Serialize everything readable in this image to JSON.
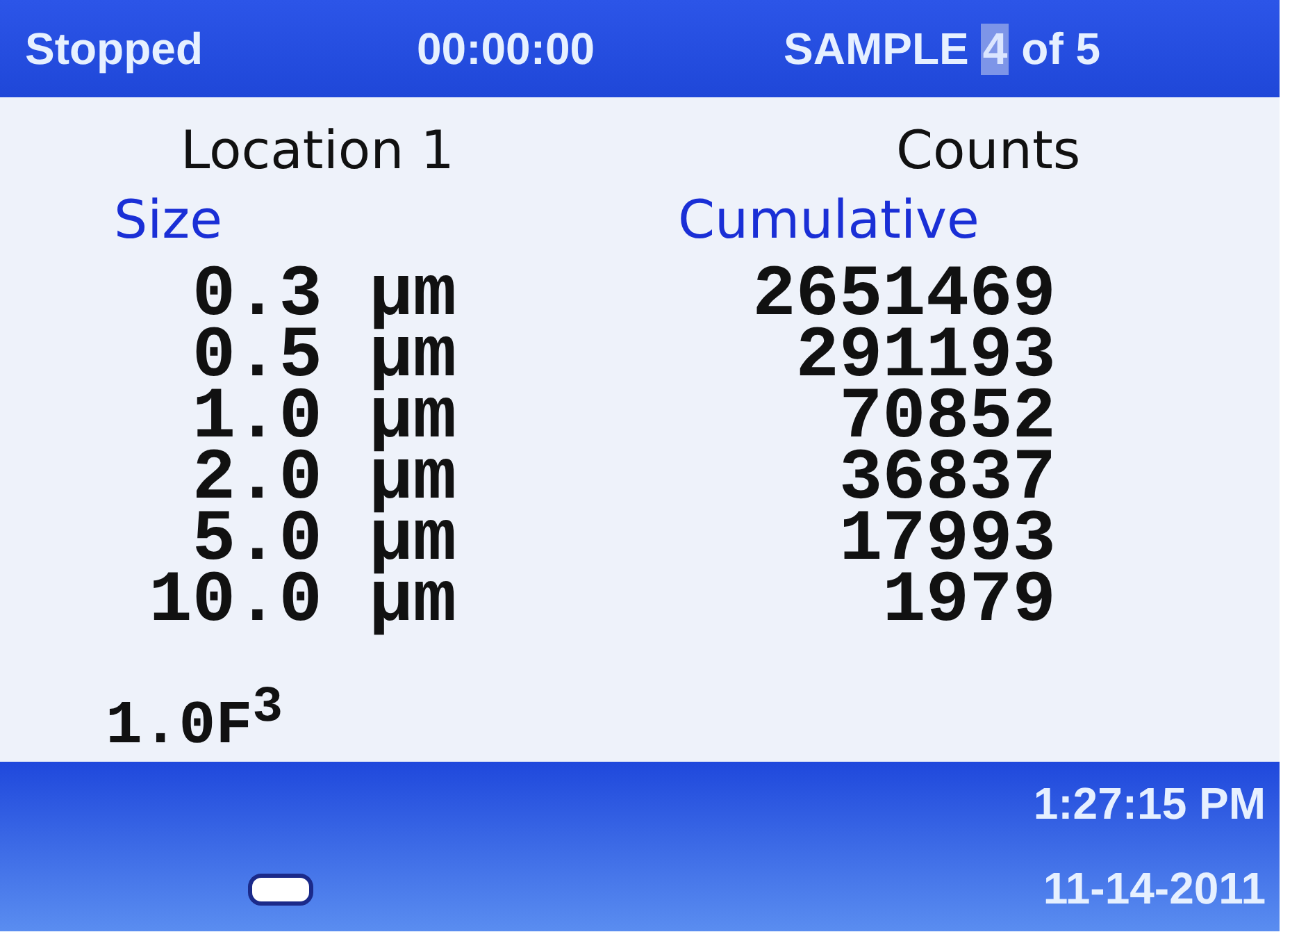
{
  "top_bar": {
    "status": "Stopped",
    "elapsed": "00:00:00",
    "sample": {
      "prefix": "SAMPLE",
      "current": "4",
      "suffix": "of 5"
    }
  },
  "header": {
    "location": "Location 1",
    "mode": "Counts"
  },
  "columns": {
    "size": "Size",
    "count": "Cumulative"
  },
  "rows": [
    {
      "size": "0.3",
      "unit": "µm",
      "count": "2651469"
    },
    {
      "size": "0.5",
      "unit": "µm",
      "count": "291193"
    },
    {
      "size": "1.0",
      "unit": "µm",
      "count": "70852"
    },
    {
      "size": "2.0",
      "unit": "µm",
      "count": "36837"
    },
    {
      "size": "5.0",
      "unit": "µm",
      "count": "17993"
    },
    {
      "size": "10.0",
      "unit": "µm",
      "count": "1979"
    }
  ],
  "volume": "1.0F$^{3}$",
  "bottom_bar": {
    "time": "1:27:15 PM",
    "date": "11-14-2011"
  }
}
